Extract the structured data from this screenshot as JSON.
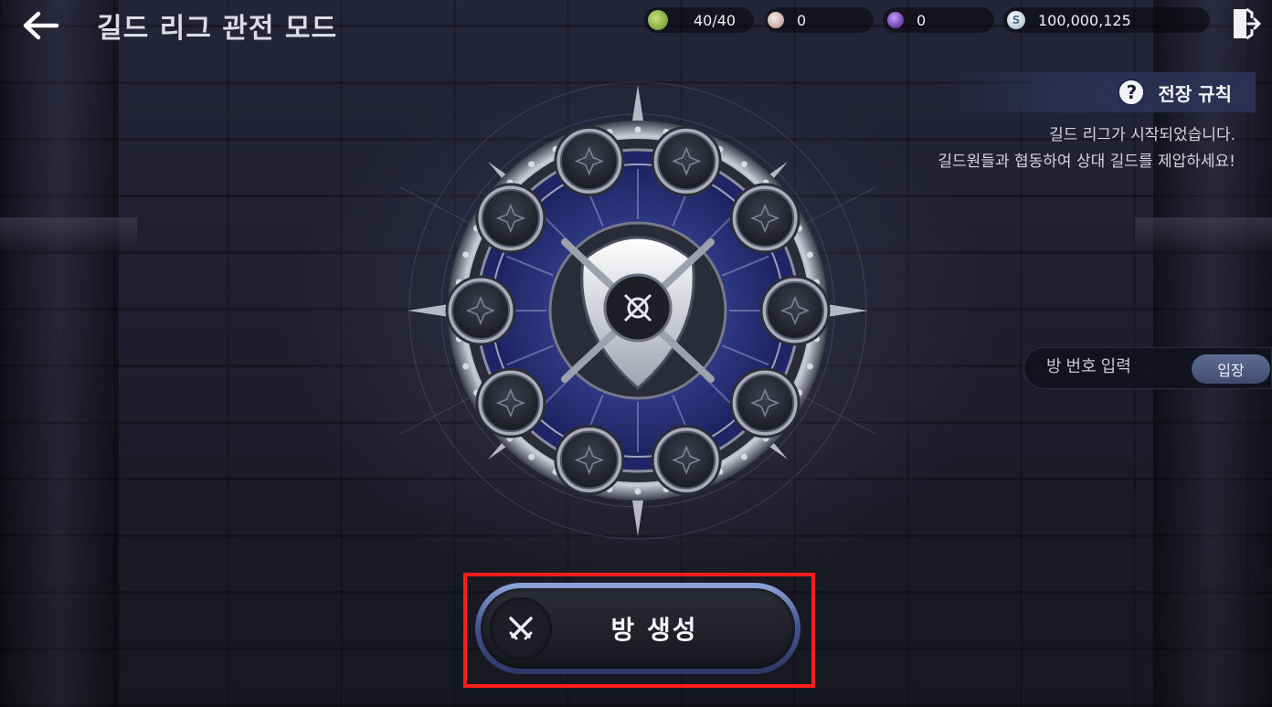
{
  "header": {
    "title": "길드 리그 관전 모드",
    "back_icon": "arrow-left-icon",
    "exit_icon": "exit-door-icon"
  },
  "resources": {
    "stamina": "40/40",
    "pearl": "0",
    "gem": "0",
    "silver": "100,000,125",
    "silver_symbol": "S"
  },
  "rules": {
    "icon_glyph": "?",
    "label": "전장 규칙",
    "notice_line1": "길드 리그가 시작되었습니다.",
    "notice_line2": "길드원들과 협동하여 상대 길드를 제압하세요!"
  },
  "room_entry": {
    "placeholder": "방 번호 입력",
    "enter_label": "입장"
  },
  "create_room": {
    "label": "방 생성",
    "icon": "crossed-swords-icon"
  },
  "emblem": {
    "slot_count": 10,
    "slot_icon": "compass-star-icon",
    "center_icon": "guild-crest-icon"
  },
  "colors": {
    "highlight": "#ff1d1d",
    "accent_blue": "#2c3a86",
    "button_rim": "#8fa6dc"
  }
}
